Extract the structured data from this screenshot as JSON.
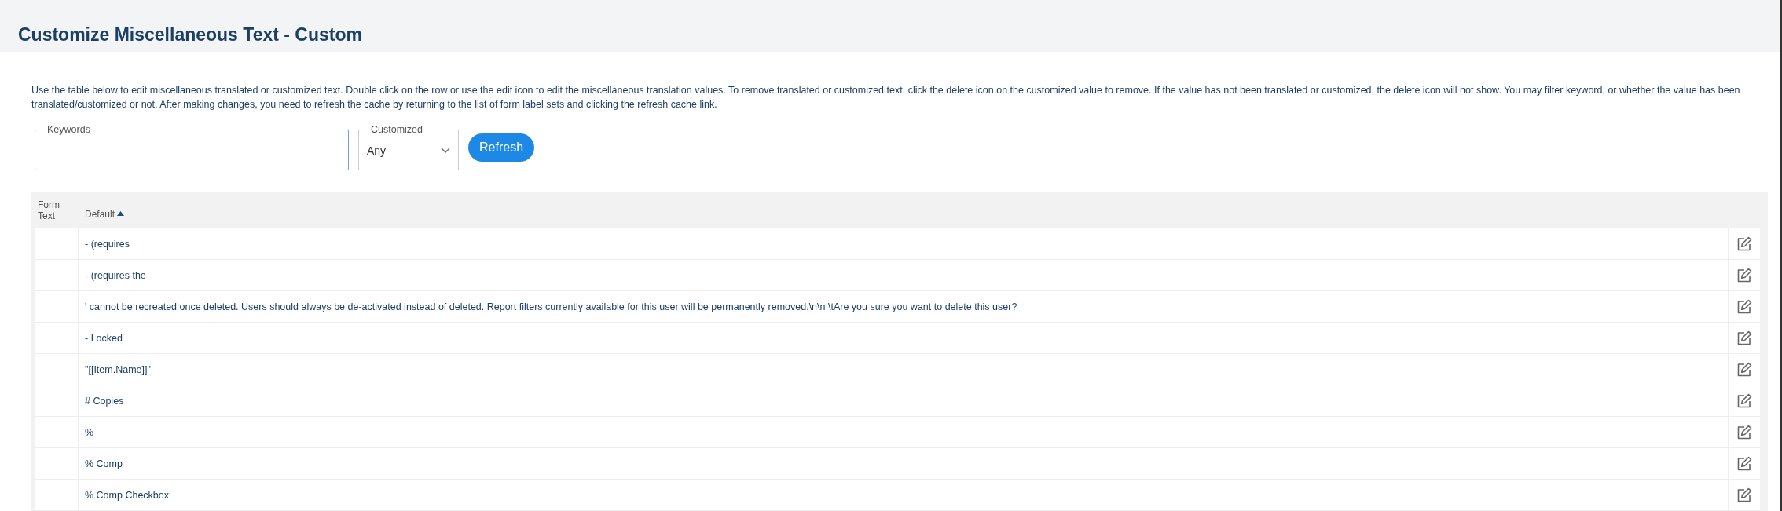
{
  "page": {
    "title": "Customize Miscellaneous Text - Custom"
  },
  "description": "Use the table below to edit miscellaneous translated or customized text. Double click on the row or use the edit icon to edit the miscellaneous translation values. To remove translated or customized text, click the delete icon on the customized value to remove. If the value has not been translated or customized, the delete icon will not show. You may filter keyword, or whether the value has been translated/customized or not. After making changes, you need to refresh the cache by returning to the list of form label sets and clicking the refresh cache link.",
  "filters": {
    "keywords": {
      "label": "Keywords"
    },
    "customized": {
      "label": "Customized",
      "value": "Any"
    },
    "refresh_button": "Refresh"
  },
  "table": {
    "columns": [
      {
        "label": "Form Text",
        "sorted": false
      },
      {
        "label": "Default",
        "sorted": true
      }
    ],
    "rows": [
      {
        "form_text": "",
        "default": "- (requires"
      },
      {
        "form_text": "",
        "default": "- (requires the"
      },
      {
        "form_text": "",
        "default": "' cannot be recreated once deleted. Users should always be de-activated instead of deleted. Report filters currently available for this user will be permanently removed.\\n\\n \\tAre you sure you want to delete this user?"
      },
      {
        "form_text": "",
        "default": "- Locked"
      },
      {
        "form_text": "",
        "default": "\"[[Item.Name]]\""
      },
      {
        "form_text": "",
        "default": "# Copies"
      },
      {
        "form_text": "",
        "default": "%"
      },
      {
        "form_text": "",
        "default": "% Comp"
      },
      {
        "form_text": "",
        "default": "% Comp Checkbox"
      }
    ]
  }
}
